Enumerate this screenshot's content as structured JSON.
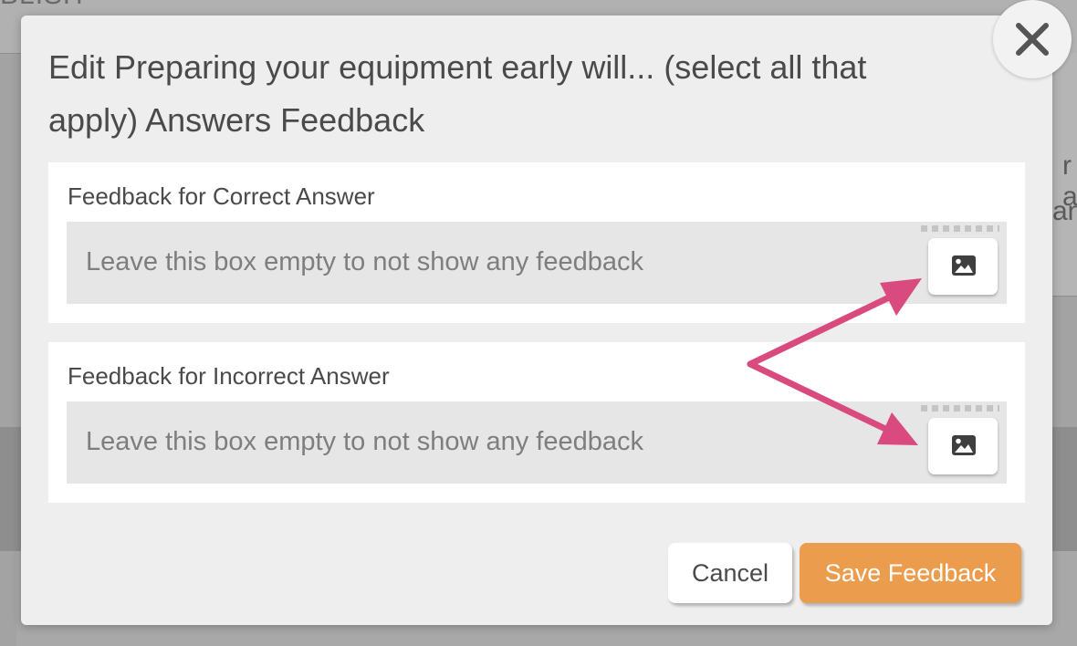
{
  "background": {
    "topbar_text": "BLISH",
    "card_text_line1": "r a",
    "card_text_line2": "an"
  },
  "modal": {
    "title": "Edit Preparing your equipment early will... (select all that apply) Answers Feedback",
    "close_icon": "close-icon",
    "sections": [
      {
        "label": "Feedback for Correct Answer",
        "placeholder": "Leave this box empty to not show any feedback",
        "value": "",
        "image_button_icon": "image-icon"
      },
      {
        "label": "Feedback for Incorrect Answer",
        "placeholder": "Leave this box empty to not show any feedback",
        "value": "",
        "image_button_icon": "image-icon"
      }
    ],
    "buttons": {
      "cancel_label": "Cancel",
      "save_label": "Save Feedback"
    }
  },
  "annotation": {
    "arrow_color": "#d94a7e"
  },
  "colors": {
    "save_button": "#ec9c4d",
    "modal_background": "#eeeeee",
    "input_background": "#e6e6e6"
  }
}
